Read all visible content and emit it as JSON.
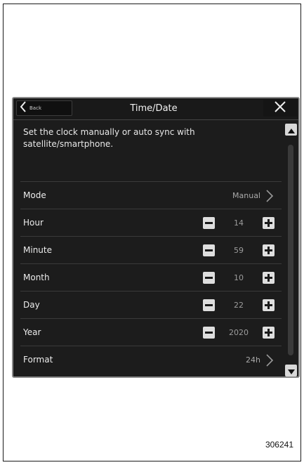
{
  "header": {
    "back_label": "Back",
    "title": "Time/Date"
  },
  "description": "Set the clock manually or auto sync with satellite/smartphone.",
  "settings": {
    "mode": {
      "label": "Mode",
      "value": "Manual"
    },
    "hour": {
      "label": "Hour",
      "value": "14"
    },
    "minute": {
      "label": "Minute",
      "value": "59"
    },
    "month": {
      "label": "Month",
      "value": "10"
    },
    "day": {
      "label": "Day",
      "value": "22"
    },
    "year": {
      "label": "Year",
      "value": "2020"
    },
    "format": {
      "label": "Format",
      "value": "24h"
    }
  },
  "figure_id": "306241",
  "icons": {
    "back": "chevron-left-icon",
    "close": "close-icon",
    "scroll_up": "triangle-up-icon",
    "scroll_down": "triangle-down-icon",
    "decrement": "minus-icon",
    "increment": "plus-icon",
    "navigate": "chevron-right-icon"
  }
}
